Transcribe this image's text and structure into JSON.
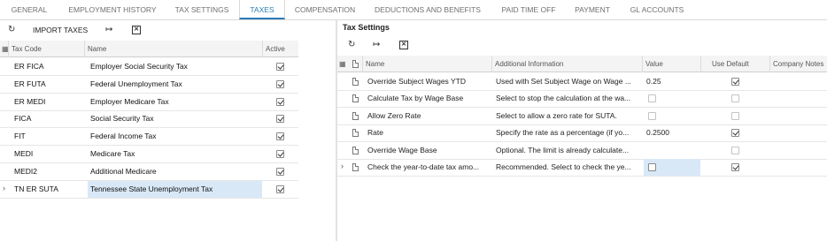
{
  "tabs": [
    {
      "label": "GENERAL"
    },
    {
      "label": "EMPLOYMENT HISTORY"
    },
    {
      "label": "TAX SETTINGS"
    },
    {
      "label": "TAXES"
    },
    {
      "label": "COMPENSATION"
    },
    {
      "label": "DEDUCTIONS AND BENEFITS"
    },
    {
      "label": "PAID TIME OFF"
    },
    {
      "label": "PAYMENT"
    },
    {
      "label": "GL ACCOUNTS"
    }
  ],
  "active_tab": "TAXES",
  "left": {
    "toolbar": {
      "refresh_icon": "refresh-icon",
      "import_label": "IMPORT TAXES",
      "fit_icon": "fit-columns-icon",
      "export_icon": "export-excel-icon"
    },
    "columns": {
      "tax_code": "Tax Code",
      "name": "Name",
      "active": "Active"
    },
    "rows": [
      {
        "code": "ER FICA",
        "name": "Employer Social Security Tax",
        "active": true
      },
      {
        "code": "ER FUTA",
        "name": "Federal Unemployment Tax",
        "active": true
      },
      {
        "code": "ER MEDI",
        "name": "Employer Medicare Tax",
        "active": true
      },
      {
        "code": "FICA",
        "name": "Social Security Tax",
        "active": true
      },
      {
        "code": "FIT",
        "name": "Federal Income Tax",
        "active": true
      },
      {
        "code": "MEDI",
        "name": "Medicare Tax",
        "active": true
      },
      {
        "code": "MEDI2",
        "name": "Additional Medicare",
        "active": true
      },
      {
        "code": "TN ER SUTA",
        "name": "Tennessee State Unemployment Tax",
        "active": true
      }
    ]
  },
  "right": {
    "title": "Tax Settings",
    "toolbar": {
      "refresh_icon": "refresh-icon",
      "fit_icon": "fit-columns-icon",
      "export_icon": "export-excel-icon"
    },
    "columns": {
      "name": "Name",
      "info": "Additional Information",
      "value": "Value",
      "use_default": "Use Default",
      "notes": "Company Notes"
    },
    "rows": [
      {
        "name": "Override Subject Wages YTD",
        "info": "Used with Set Subject Wage on Wage ...",
        "value": "0.25",
        "value_checkbox": false,
        "use_default": true,
        "use_default_enabled": true
      },
      {
        "name": "Calculate Tax by Wage Base",
        "info": "Select to stop the calculation at the wa...",
        "value": "",
        "value_checkbox": true,
        "value_checked": false,
        "use_default": false,
        "use_default_enabled": false
      },
      {
        "name": "Allow Zero Rate",
        "info": "Select to allow a zero rate for SUTA.",
        "value": "",
        "value_checkbox": true,
        "value_checked": false,
        "use_default": false,
        "use_default_enabled": false
      },
      {
        "name": "Rate",
        "info": "Specify the rate as a percentage (if yo...",
        "value": "0.2500",
        "value_checkbox": false,
        "use_default": true,
        "use_default_enabled": true
      },
      {
        "name": "Override Wage Base",
        "info": "Optional. The limit is already calculate...",
        "value": "",
        "value_checkbox": false,
        "use_default": false,
        "use_default_enabled": false
      },
      {
        "name": "Check the year-to-date tax amo...",
        "info": "Recommended. Select to check the ye...",
        "value": "",
        "value_checkbox": true,
        "value_checked": false,
        "use_default": true,
        "use_default_enabled": true
      }
    ]
  }
}
